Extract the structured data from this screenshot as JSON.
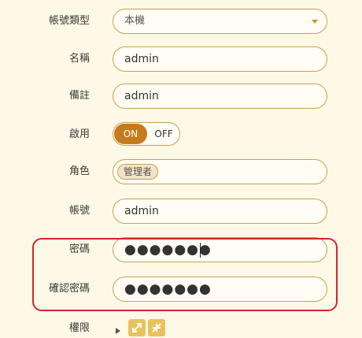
{
  "form": {
    "account_type": {
      "label": "帳號類型",
      "value": "本機"
    },
    "name": {
      "label": "名稱",
      "value": "admin"
    },
    "note": {
      "label": "備註",
      "value": "admin"
    },
    "enabled": {
      "label": "啟用",
      "on_label": "ON",
      "off_label": "OFF",
      "state": "on"
    },
    "role": {
      "label": "角色",
      "tags": [
        "管理者"
      ]
    },
    "account": {
      "label": "帳號",
      "value": "admin"
    },
    "password": {
      "label": "密碼",
      "masked_value": "●●●●●●●"
    },
    "confirm_password": {
      "label": "確認密碼",
      "masked_value": "●●●●●●●"
    },
    "permissions": {
      "label": "權限"
    }
  },
  "colors": {
    "background": "#fdf9e6",
    "border": "#c9a052",
    "toggle_on": "#c57a1c",
    "highlight": "#d8232a",
    "permission_button": "#e8c35d"
  }
}
